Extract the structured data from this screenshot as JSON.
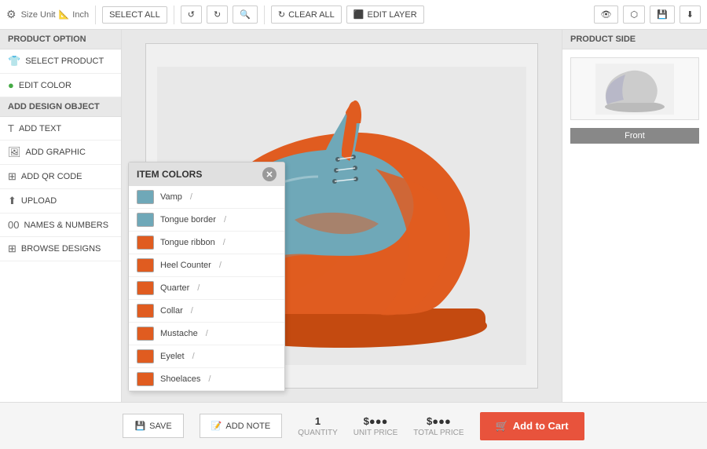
{
  "toolbar": {
    "rotate_icon": "↺",
    "redo_icon": "↻",
    "zoom_icon": "🔍",
    "size_unit_label": "Size Unit",
    "size_unit_value": "Inch",
    "select_all_label": "SELECT ALL",
    "clear_all_label": "CLEAR ALL",
    "edit_layer_label": "EDIT LAYER",
    "eye_icon": "👁",
    "share_icon": "⬡",
    "save_icon": "💾",
    "download_icon": "⬇"
  },
  "left_panel": {
    "product_option_title": "PRODUCT OPTION",
    "select_product_label": "SELECT PRODUCT",
    "edit_color_label": "EDIT COLOR",
    "add_design_title": "ADD DESIGN OBJECT",
    "add_text_label": "ADD TEXT",
    "add_graphic_label": "ADD GRAPHIC",
    "add_qr_label": "ADD QR CODE",
    "upload_label": "UPLOAD",
    "names_label": "NAMES & NUMBERS",
    "browse_label": "BROWSE DESIGNS"
  },
  "item_colors": {
    "title": "ITEM COLORS",
    "items": [
      {
        "name": "Vamp",
        "color": "#6fa8b8",
        "slash": "/"
      },
      {
        "name": "Tongue border",
        "color": "#6fa8b8",
        "slash": "/"
      },
      {
        "name": "Tongue ribbon",
        "color": "#e05c20",
        "slash": "/"
      },
      {
        "name": "Heel Counter",
        "color": "#e05c20",
        "slash": "/"
      },
      {
        "name": "Quarter",
        "color": "#e05c20",
        "slash": "/"
      },
      {
        "name": "Collar",
        "color": "#e05c20",
        "slash": "/"
      },
      {
        "name": "Mustache",
        "color": "#e05c20",
        "slash": "/"
      },
      {
        "name": "Eyelet",
        "color": "#e05c20",
        "slash": "/"
      },
      {
        "name": "Shoelaces",
        "color": "#e05c20",
        "slash": "/"
      }
    ]
  },
  "right_panel": {
    "title": "PRODUCT SIDE",
    "front_label": "Front"
  },
  "bottom_bar": {
    "save_label": "SAVE",
    "add_note_label": "ADD NOTE",
    "quantity": "1",
    "quantity_label": "QUANTITY",
    "unit_price_label": "UNIT PRICE",
    "total_price_label": "TOTAL PRICE",
    "add_to_cart_label": "Add to Cart",
    "cart_icon": "🛒"
  }
}
